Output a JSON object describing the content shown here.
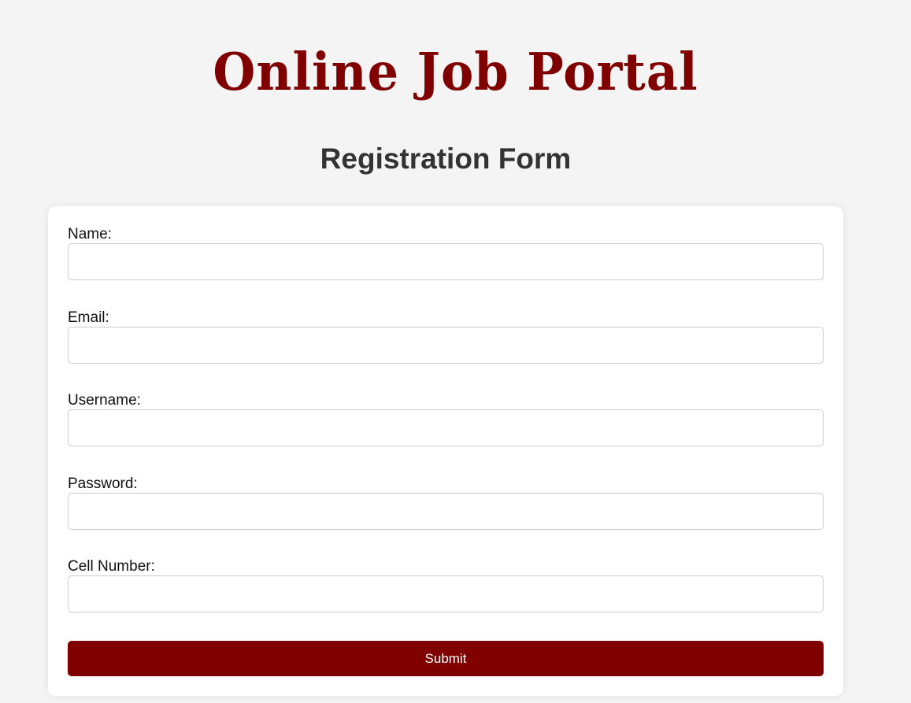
{
  "header": {
    "logo_text": "Online Job Portal",
    "form_title": "Registration Form"
  },
  "form": {
    "fields": [
      {
        "label": "Name:",
        "value": "",
        "placeholder": ""
      },
      {
        "label": "Email:",
        "value": "",
        "placeholder": ""
      },
      {
        "label": "Username:",
        "value": "",
        "placeholder": ""
      },
      {
        "label": "Password:",
        "value": "",
        "placeholder": ""
      },
      {
        "label": "Cell Number:",
        "value": "",
        "placeholder": ""
      }
    ],
    "submit_label": "Submit"
  },
  "colors": {
    "brand": "#800000",
    "page_background": "#f4f4f4",
    "card_background": "#ffffff",
    "title_text": "#333333"
  }
}
